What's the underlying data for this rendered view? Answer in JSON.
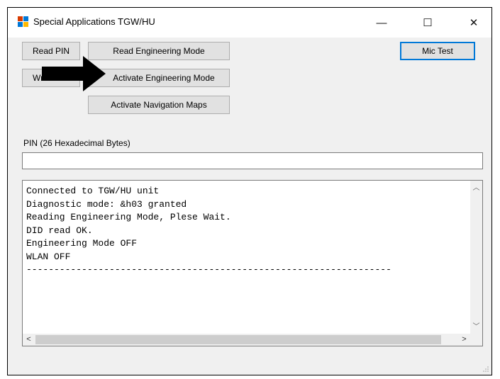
{
  "window": {
    "title": "Special Applications TGW/HU"
  },
  "title_controls": {
    "minimize": "—",
    "maximize": "☐",
    "close": "✕"
  },
  "buttons": {
    "read_pin": "Read PIN",
    "write_pin": "Wr",
    "read_engineering_mode": "Read Engineering Mode",
    "activate_engineering_mode": "Activate Engineering Mode",
    "activate_navigation_maps": "Activate Navigation Maps",
    "mic_test": "Mic Test"
  },
  "pin": {
    "label": "PIN (26 Hexadecimal Bytes)",
    "value": ""
  },
  "log": {
    "text": "Connected to TGW/HU unit\nDiagnostic mode: &h03 granted\nReading Engineering Mode, Plese Wait.\nDID read OK.\nEngineering Mode OFF\nWLAN OFF\n------------------------------------------------------------------"
  },
  "scroll_arrows": {
    "up": "︿",
    "down": "﹀",
    "left": "<",
    "right": ">"
  },
  "annotation": {
    "arrow_color": "#000000"
  },
  "icons": {
    "app": "app-window-icon",
    "arrow": "pointer-arrow-icon"
  }
}
